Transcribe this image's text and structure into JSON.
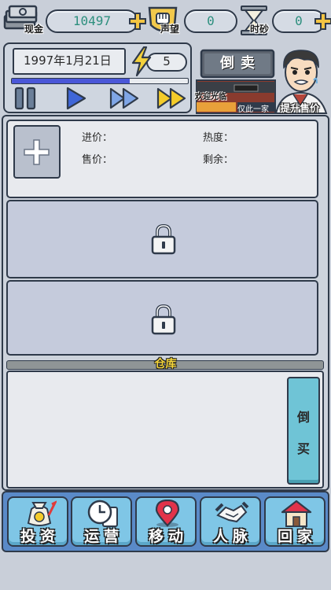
{
  "resources": {
    "cash": {
      "label": "现金",
      "value": "10497"
    },
    "reputation": {
      "label": "声望",
      "value": "0"
    },
    "time": {
      "label": "时砂",
      "value": "0"
    }
  },
  "status": {
    "date": "1997年1月21日",
    "energy": "5",
    "day_progress": 0.67
  },
  "shop": {
    "sign": "倒卖",
    "banner": "欢迎光临",
    "marquee": "仅此一家",
    "upgrade_label": "提升售价"
  },
  "slot": {
    "buy_price_label": "进价：",
    "sell_price_label": "售价：",
    "popularity_label": "热度：",
    "remaining_label": "剩余："
  },
  "warehouse": {
    "title": "仓库",
    "sell_button": [
      "倒",
      "买"
    ]
  },
  "nav": [
    {
      "label": "投资",
      "icon": "money-bag-icon"
    },
    {
      "label": "运营",
      "icon": "clock-document-icon"
    },
    {
      "label": "移动",
      "icon": "map-pin-icon"
    },
    {
      "label": "人脉",
      "icon": "handshake-icon"
    },
    {
      "label": "回家",
      "icon": "house-icon"
    }
  ],
  "colors": {
    "accent_teal": "#2d8f7e",
    "nav_bg": "#5a8ac8",
    "nav_button": "#7fc6e6",
    "sell_button": "#6fc4d6",
    "progress": "#4a57d8",
    "bolt": "#f4d23c"
  }
}
